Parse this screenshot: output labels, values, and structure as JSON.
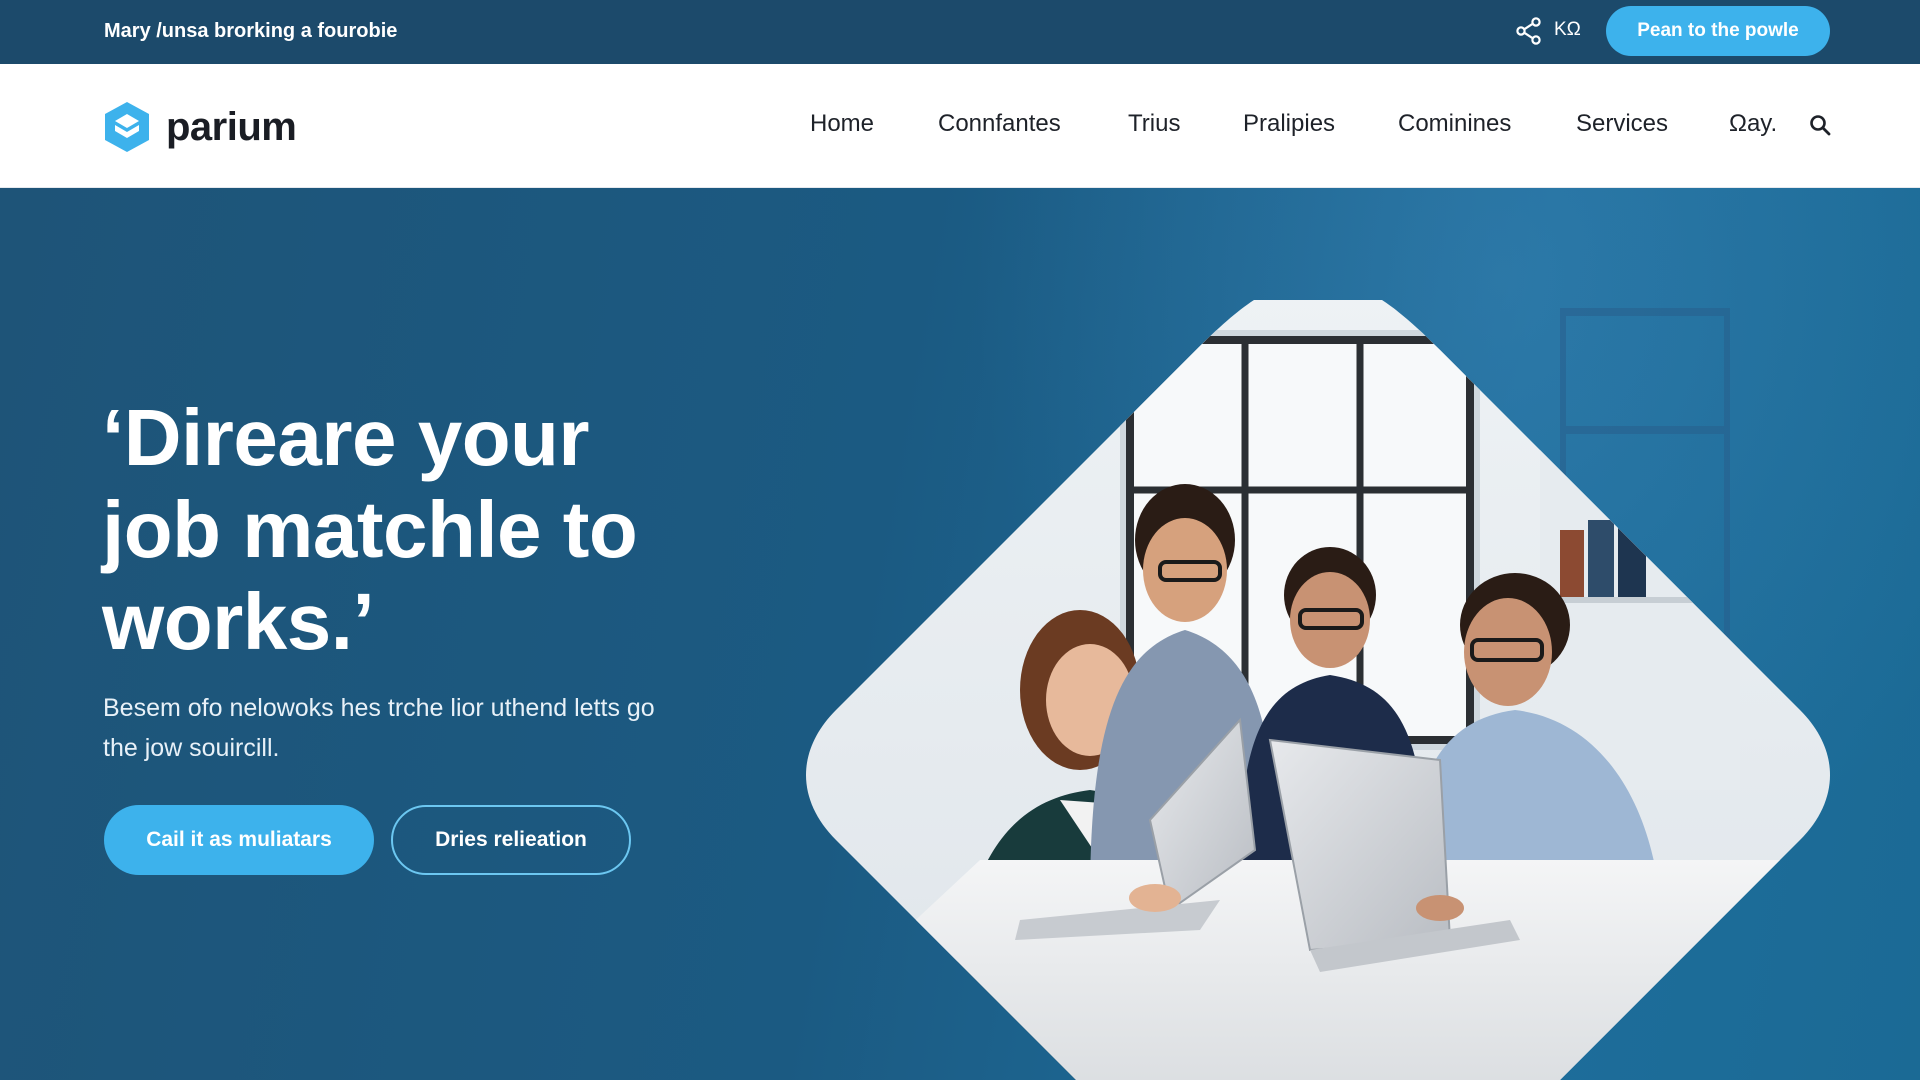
{
  "topbar": {
    "tagline": "Mary /unsa brorking a fourobie",
    "language": "KΩ",
    "cta_label": "Pean to the powle"
  },
  "brand": {
    "name": "parium",
    "logo_color": "#3db2ec"
  },
  "nav": {
    "items": [
      {
        "label": "Home"
      },
      {
        "label": "Connfantes"
      },
      {
        "label": "Trius"
      },
      {
        "label": "Pralipies"
      },
      {
        "label": "Cominines"
      },
      {
        "label": "Services"
      },
      {
        "label": "Ωay."
      }
    ],
    "search_icon": "search-icon"
  },
  "hero": {
    "headline": "‘Direare your job matchle to works.’",
    "subtext": "Besem ofo nelowoks hes trche lior uthend letts go the jow souircill.",
    "primary_cta": "Cail it as muliatars",
    "secondary_cta": "Dries relieation",
    "photo_description_icon": "team-photo"
  },
  "colors": {
    "topbar_bg": "#1c4a6b",
    "accent": "#3db2ec",
    "hero_bg": "#1e5a80",
    "nav_text": "#1e2229"
  }
}
